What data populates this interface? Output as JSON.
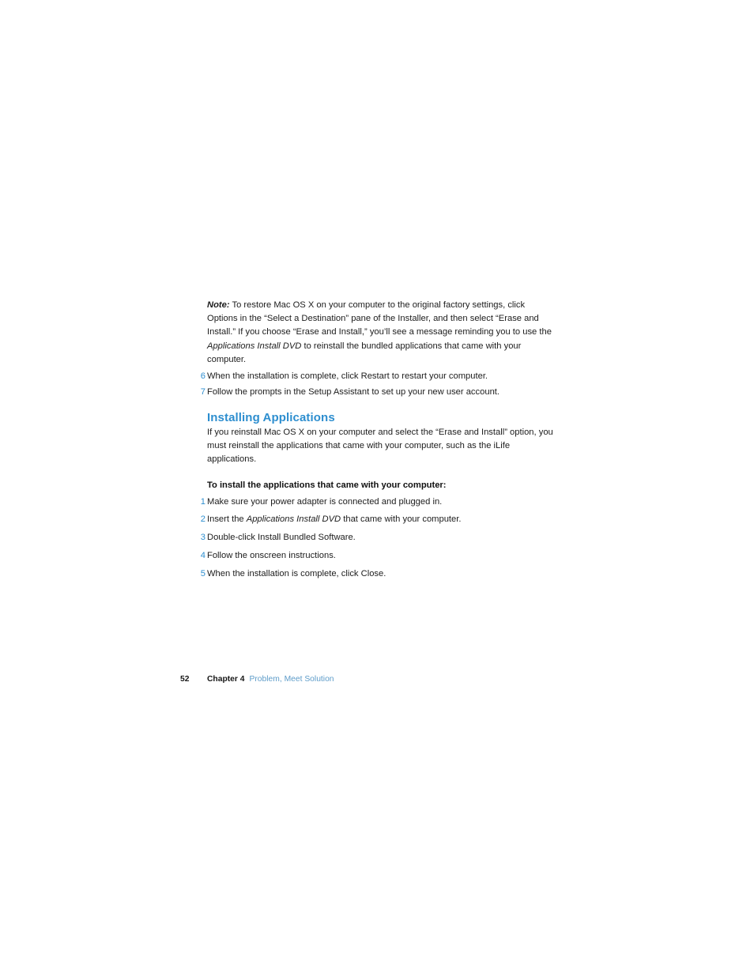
{
  "page": {
    "number": "52",
    "chapter_label": "Chapter 4",
    "chapter_title": "Problem, Meet Solution"
  },
  "note": {
    "label": "Note:",
    "colon": "",
    "text_part1": " To restore Mac OS X on your computer to the original factory settings, click Options in the “Select a Destination” pane of the Installer, and then select “Erase and Install.” If you choose “Erase and Install,” you’ll see a message reminding you to use the ",
    "italic_title": "Applications Install DVD",
    "text_part2": " to reinstall the bundled applications that came with your computer."
  },
  "continued_steps": [
    {
      "num": "6",
      "text": "When the installation is complete, click Restart to restart your computer."
    },
    {
      "num": "7",
      "text": "Follow the prompts in the Setup Assistant to set up your new user account."
    }
  ],
  "section": {
    "heading": "Installing Applications",
    "intro": "If you reinstall Mac OS X on your computer and select the “Erase and Install” option, you must reinstall the applications that came with your computer, such as the iLife applications.",
    "lead_in": "To install the applications that came with your computer:"
  },
  "install_steps": [
    {
      "num": "1",
      "text_part1": "Make sure your power adapter is connected and plugged in.",
      "italic_title": "",
      "text_part2": ""
    },
    {
      "num": "2",
      "text_part1": "Insert the ",
      "italic_title": "Applications Install DVD",
      "text_part2": " that came with your computer."
    },
    {
      "num": "3",
      "text_part1": "Double-click Install Bundled Software.",
      "italic_title": "",
      "text_part2": ""
    },
    {
      "num": "4",
      "text_part1": "Follow the onscreen instructions.",
      "italic_title": "",
      "text_part2": ""
    },
    {
      "num": "5",
      "text_part1": "When the installation is complete, click Close.",
      "italic_title": "",
      "text_part2": ""
    }
  ],
  "colors": {
    "heading_blue": "#2d8ecf",
    "numeral_blue": "#2f8fd0",
    "footer_link_blue": "#5e9cc9",
    "body_text": "#1c1c1c"
  }
}
